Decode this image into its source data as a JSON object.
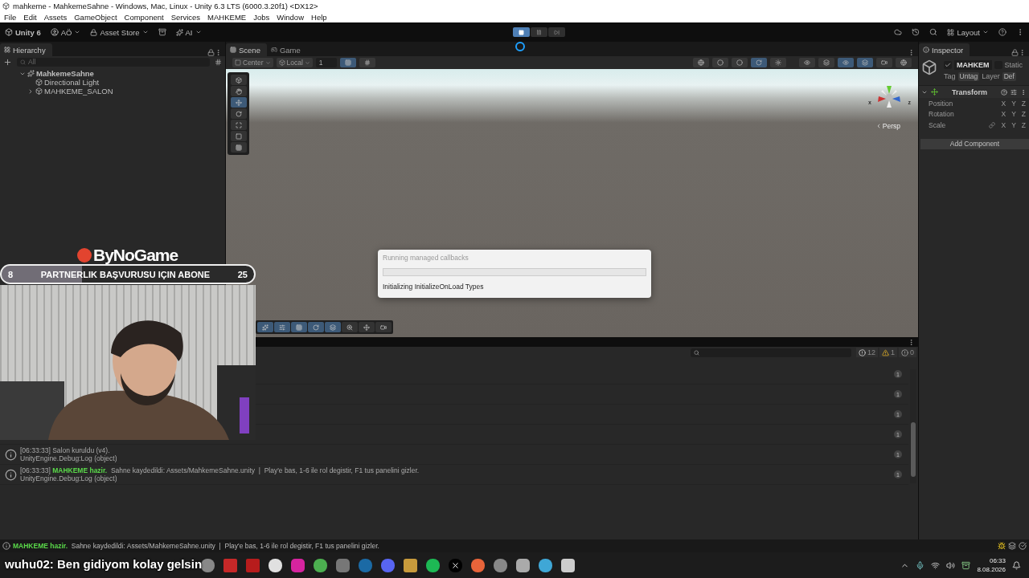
{
  "window": {
    "title": "mahkeme - MahkemeSahne - Windows, Mac, Linux - Unity 6.3 LTS (6000.3.20f1) <DX12>"
  },
  "menu": [
    "File",
    "Edit",
    "Assets",
    "GameObject",
    "Component",
    "Services",
    "MAHKEME",
    "Jobs",
    "Window",
    "Help"
  ],
  "toolbar": {
    "product": "Unity 6",
    "account": "AÖ",
    "asset_store": "Asset Store",
    "ai": "AI",
    "layout": "Layout",
    "play_buttons": [
      {
        "kind": "play",
        "selected": true
      },
      {
        "kind": "pause",
        "selected": false
      },
      {
        "kind": "step",
        "selected": false
      }
    ]
  },
  "hierarchy": {
    "tab": {
      "label": "Hierarchy",
      "selected": true
    },
    "search": {
      "placeholder": "All"
    },
    "items": [
      {
        "label": "MahkemeSahne",
        "kind": "scene",
        "expanded": true,
        "children": [
          {
            "label": "Directional Light",
            "kind": "object"
          },
          {
            "label": "MAHKEME_SALON",
            "kind": "object",
            "expanded": false
          }
        ]
      }
    ]
  },
  "scene_view": {
    "tabs": [
      {
        "label": "Scene",
        "selected": true
      },
      {
        "label": "Game",
        "selected": false
      }
    ],
    "pivot": "Center",
    "space": "Local",
    "grid_size": "1",
    "camera": "Persp",
    "axis_labels": [
      "x",
      "z"
    ]
  },
  "inspector": {
    "tab": {
      "label": "Inspector",
      "selected": true
    },
    "active": true,
    "name": "MAHKEM",
    "static_label": "Static",
    "static": false,
    "tag_label": "Tag",
    "tag": "Untag",
    "layer_label": "Layer",
    "layer": "Def",
    "component": {
      "title": "Transform",
      "expanded": true,
      "fields": [
        {
          "label": "Position",
          "kind": "vector",
          "axes": [
            "X",
            "Y",
            "Z"
          ]
        },
        {
          "label": "Rotation",
          "kind": "vector",
          "axes": [
            "X",
            "Y",
            "Z"
          ]
        },
        {
          "label": "Scale",
          "kind": "linked",
          "axes": [
            "X",
            "Y",
            "Z"
          ]
        }
      ]
    },
    "add_component": "Add Component"
  },
  "console": {
    "counts": [
      {
        "kind": "info",
        "label": "12"
      },
      {
        "kind": "warning",
        "label": "1"
      },
      {
        "kind": "error",
        "label": "0"
      }
    ],
    "entries": [
      {
        "count": "1"
      },
      {
        "count": "1"
      },
      {
        "count": "1"
      },
      {
        "count": "1"
      },
      {
        "time": "[06:33:33]",
        "message": "Salon kuruldu (v4).",
        "trace": "UnityEngine.Debug:Log (object)",
        "count": "1"
      },
      {
        "time": "[06:33:33]",
        "message": "**MAHKEME hazir.**  Sahne kaydedildi: Assets/MahkemeSahne.unity  |  Play'e bas, 1-6 ile rol degistir, F1 tus panelini gizler.",
        "trace": "UnityEngine.Debug:Log (object)",
        "count": "1"
      }
    ]
  },
  "status_bar": {
    "message": "**MAHKEME hazir.**  Sahne kaydedildi: Assets/MahkemeSahne.unity  |  Play'e bas, 1-6 ile rol degistir, F1 tus panelini gizler."
  },
  "progress_dialog": {
    "title": "Running managed callbacks",
    "level": 0,
    "info": "Initializing InitializeOnLoad Types"
  },
  "stream_overlay": {
    "logo": "ByNoGame",
    "goal": {
      "current": "8",
      "label": "PARTNERLIK BAŞVURUSU IÇIN ABONE",
      "target": "25",
      "level": 0.32
    },
    "chat": "wuhu02: Ben gidiyom kolay gelsin"
  },
  "taskbar": {
    "time": "06:33",
    "date": "8.08.2026"
  }
}
